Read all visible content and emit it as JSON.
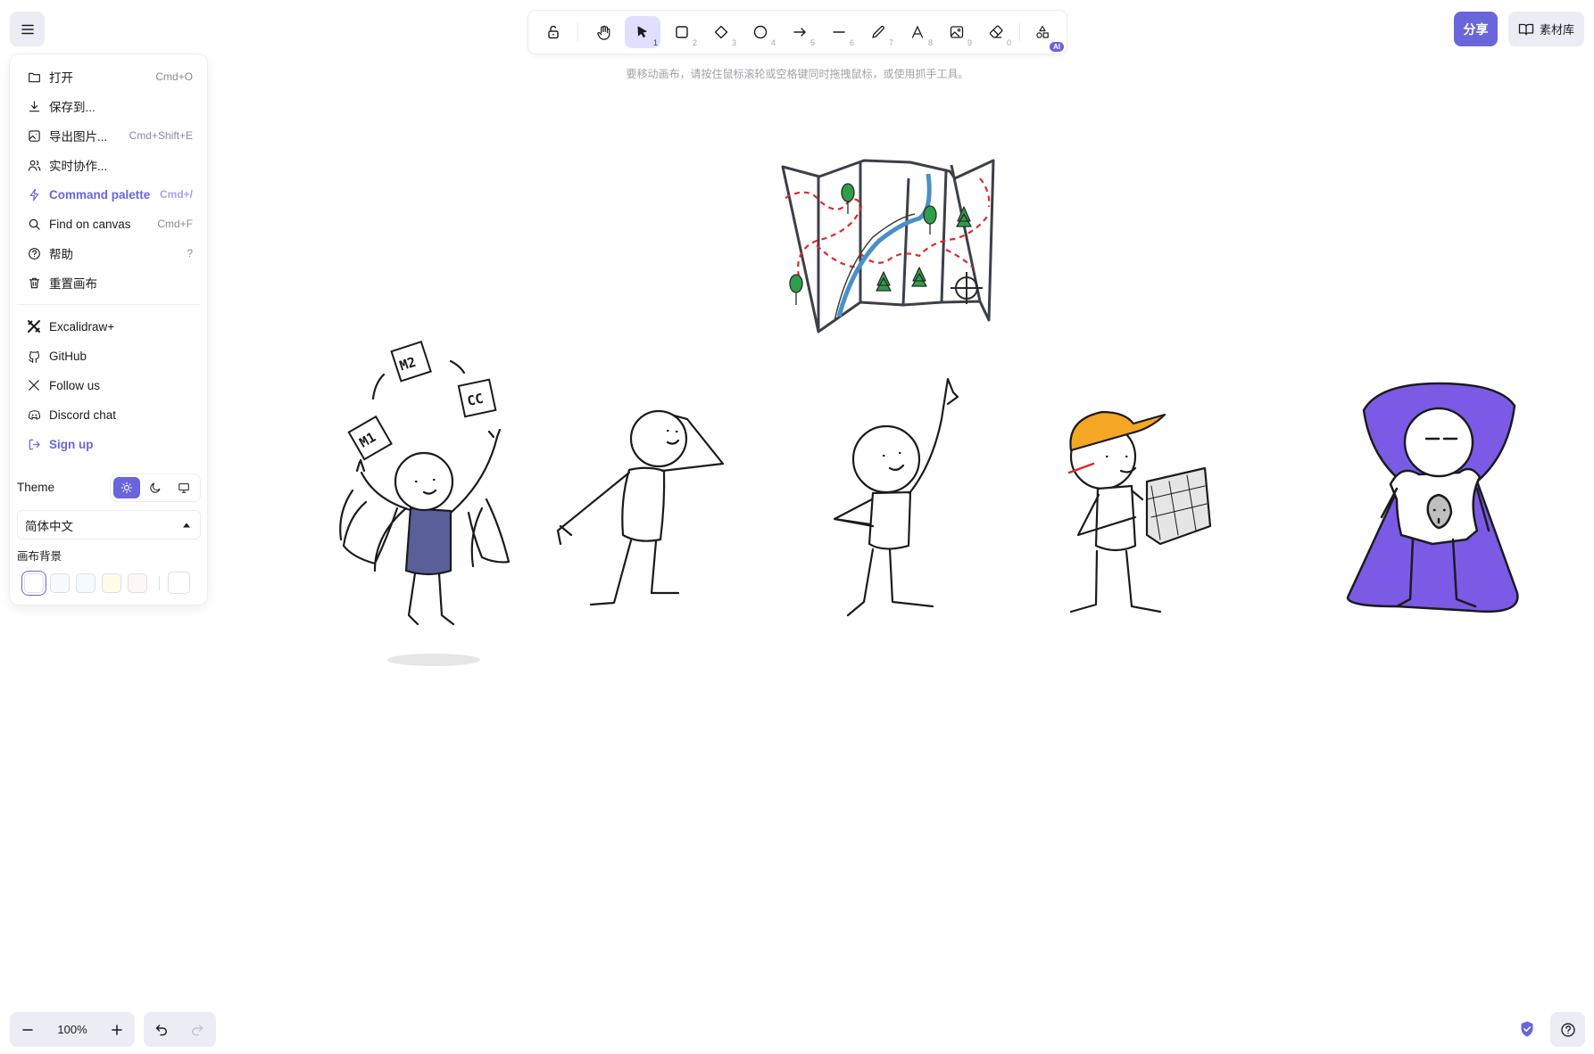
{
  "toolbar": {
    "tools": [
      {
        "name": "lock",
        "num": ""
      },
      {
        "name": "hand",
        "num": ""
      },
      {
        "name": "selection",
        "num": "1"
      },
      {
        "name": "rectangle",
        "num": "2"
      },
      {
        "name": "diamond",
        "num": "3"
      },
      {
        "name": "ellipse",
        "num": "4"
      },
      {
        "name": "arrow",
        "num": "5"
      },
      {
        "name": "line",
        "num": "6"
      },
      {
        "name": "freedraw",
        "num": "7"
      },
      {
        "name": "text",
        "num": "8"
      },
      {
        "name": "image",
        "num": "9"
      },
      {
        "name": "eraser",
        "num": "0"
      },
      {
        "name": "extra-tools",
        "num": ""
      }
    ],
    "active_tool": "selection",
    "ai_badge": "AI"
  },
  "hint": "要移动画布，请按住鼠标滚轮或空格键同时拖拽鼠标，或使用抓手工具。",
  "top_right": {
    "share_label": "分享",
    "library_label": "素材库"
  },
  "menu": {
    "items": [
      {
        "label": "打开",
        "shortcut": "Cmd+O",
        "icon": "folder-icon"
      },
      {
        "label": "保存到...",
        "shortcut": "",
        "icon": "download-icon"
      },
      {
        "label": "导出图片...",
        "shortcut": "Cmd+Shift+E",
        "icon": "export-image-icon"
      },
      {
        "label": "实时协作...",
        "shortcut": "",
        "icon": "users-icon"
      },
      {
        "label": "Command palette",
        "shortcut": "Cmd+/",
        "icon": "bolt-icon"
      },
      {
        "label": "Find on canvas",
        "shortcut": "Cmd+F",
        "icon": "search-icon"
      },
      {
        "label": "帮助",
        "shortcut": "?",
        "icon": "help-icon"
      },
      {
        "label": "重置画布",
        "shortcut": "",
        "icon": "trash-icon"
      }
    ],
    "links": [
      {
        "label": "Excalidraw+",
        "icon": "excalidraw-plus-icon"
      },
      {
        "label": "GitHub",
        "icon": "github-icon"
      },
      {
        "label": "Follow us",
        "icon": "x-logo-icon"
      },
      {
        "label": "Discord chat",
        "icon": "discord-icon"
      },
      {
        "label": "Sign up",
        "icon": "sign-up-icon"
      }
    ],
    "theme_label": "Theme",
    "theme_active": "light",
    "language": "简体中文",
    "canvas_bg_label": "画布背景",
    "canvas_bg_colors": [
      "#ffffff",
      "#f8f9fa",
      "#f5faff",
      "#fffce8",
      "#fdf8f6"
    ],
    "canvas_bg_custom": "#ffffff"
  },
  "bottom": {
    "zoom": "100%"
  },
  "canvas": {
    "juggler_cards": [
      "M2",
      "CC",
      "M1"
    ]
  },
  "colors": {
    "accent": "#6965db",
    "accent_light": "#e0dfff",
    "island_bg": "#ececf4",
    "cape": "#7b5ae6",
    "hat": "#f5a623",
    "map_path": "#d92b2b",
    "tree": "#2e9e4a"
  }
}
